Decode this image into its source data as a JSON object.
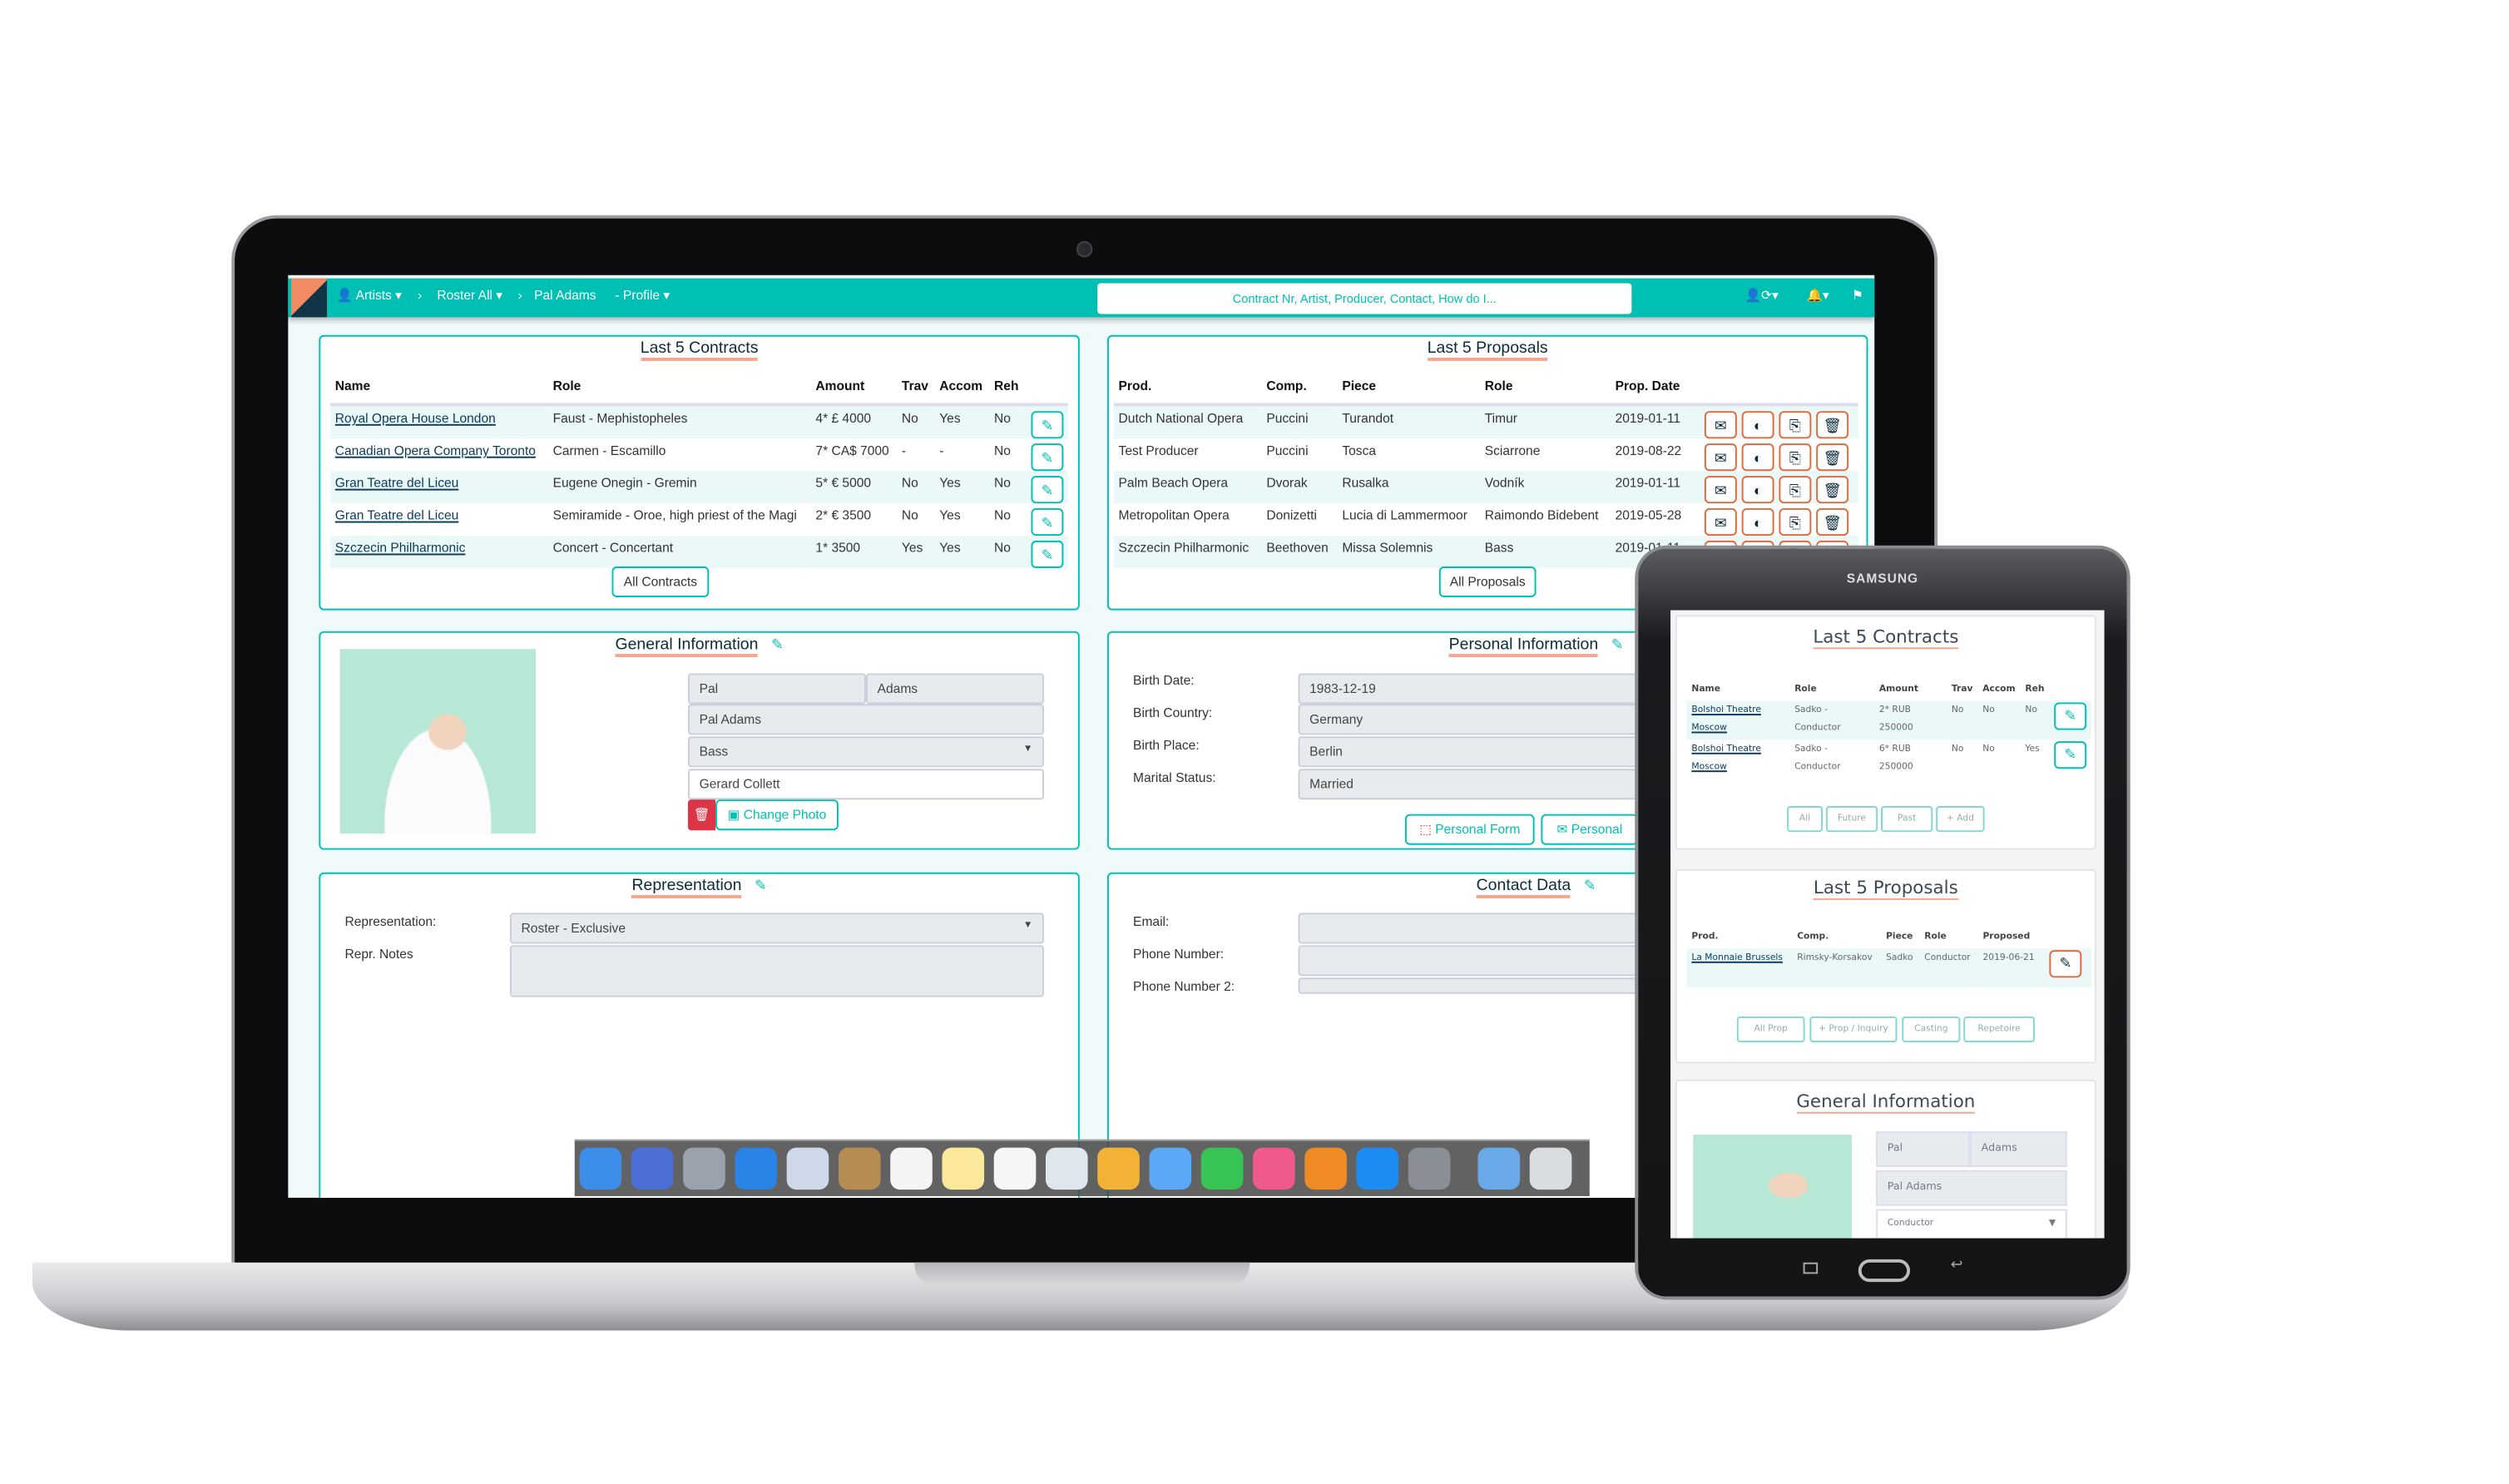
{
  "nav": {
    "breadcrumbs": [
      "Artists",
      "Roster All",
      "Pal Adams",
      "- Profile"
    ],
    "search_placeholder": "Contract Nr, Artist, Producer, Contact, How do I...",
    "icons": [
      "user-sync-icon",
      "bell-icon",
      "flag-icon"
    ]
  },
  "colors": {
    "accent": "#00bfb3",
    "highlight": "#f4a78d",
    "danger": "#dc3545"
  },
  "contracts": {
    "title": "Last 5 Contracts",
    "headers": [
      "Name",
      "Role",
      "Amount",
      "Trav",
      "Accom",
      "Reh"
    ],
    "rows": [
      [
        "Royal Opera House London",
        "Faust - Mephistopheles",
        "4* £ 4000",
        "No",
        "Yes",
        "No"
      ],
      [
        "Canadian Opera Company Toronto",
        "Carmen - Escamillo",
        "7* CA$ 7000",
        "-",
        "-",
        "No"
      ],
      [
        "Gran Teatre del Liceu",
        "Eugene Onegin - Gremin",
        "5* € 5000",
        "No",
        "Yes",
        "No"
      ],
      [
        "Gran Teatre del Liceu",
        "Semiramide - Oroe, high priest of the Magi",
        "2* € 3500",
        "No",
        "Yes",
        "No"
      ],
      [
        "Szczecin Philharmonic",
        "Concert - Concertant",
        "1* 3500",
        "Yes",
        "Yes",
        "No"
      ]
    ],
    "all_label": "All Contracts"
  },
  "proposals": {
    "title": "Last 5 Proposals",
    "headers": [
      "Prod.",
      "Comp.",
      "Piece",
      "Role",
      "Prop. Date"
    ],
    "rows": [
      [
        "Dutch National Opera",
        "Puccini",
        "Turandot",
        "Timur",
        "2019-01-11"
      ],
      [
        "Test Producer",
        "Puccini",
        "Tosca",
        "Sciarrone",
        "2019-08-22"
      ],
      [
        "Palm Beach Opera",
        "Dvorak",
        "Rusalka",
        "Vodník",
        "2019-01-11"
      ],
      [
        "Metropolitan Opera",
        "Donizetti",
        "Lucia di Lammermoor",
        "Raimondo Bidebent",
        "2019-05-28"
      ],
      [
        "Szczecin Philharmonic",
        "Beethoven",
        "Missa Solemnis",
        "Bass",
        "2019-01-11"
      ]
    ],
    "all_label": "All Proposals"
  },
  "general": {
    "title": "General Information",
    "first_name": "Pal",
    "last_name": "Adams",
    "display_name": "Pal Adams",
    "voice": "Bass",
    "manager": "Gerard Collett",
    "change_photo": "Change Photo"
  },
  "personal": {
    "title": "Personal Information",
    "labels": [
      "Birth Date:",
      "Birth Country:",
      "Birth Place:",
      "Marital Status:"
    ],
    "values": [
      "1983-12-19",
      "Germany",
      "Berlin",
      "Married"
    ],
    "form_button": "Personal Form",
    "mail_button": "Personal"
  },
  "representation": {
    "title": "Representation",
    "label": "Representation:",
    "value": "Roster - Exclusive",
    "notes_label": "Repr. Notes",
    "notes": ""
  },
  "contact": {
    "title": "Contact Data",
    "labels": [
      "Email:",
      "Phone Number:",
      "Phone Number 2:"
    ],
    "values": [
      "",
      "",
      ""
    ]
  },
  "dock": {
    "apps": [
      "finder",
      "siri",
      "launchpad",
      "safari",
      "mail",
      "contacts",
      "calendar",
      "notes",
      "reminders",
      "photos-preview",
      "photos",
      "messages",
      "facetime",
      "itunes",
      "ibooks",
      "app-store",
      "system-preferences",
      "downloads",
      "trash"
    ]
  },
  "tablet": {
    "brand": "SAMSUNG",
    "contracts": {
      "title": "Last 5 Contracts",
      "headers": [
        "Name",
        "Role",
        "Amount",
        "Trav",
        "Accom",
        "Reh"
      ],
      "rows": [
        [
          "Bolshoi Theatre Moscow",
          "Sadko - Conductor",
          "2* RUB 250000",
          "No",
          "No",
          "No"
        ],
        [
          "Bolshoi Theatre Moscow",
          "Sadko - Conductor",
          "6* RUB 250000",
          "No",
          "No",
          "Yes"
        ]
      ],
      "buttons": [
        "All",
        "Future",
        "Past",
        "+ Add"
      ]
    },
    "proposals": {
      "title": "Last 5 Proposals",
      "headers": [
        "Prod.",
        "Comp.",
        "Piece",
        "Role",
        "Proposed"
      ],
      "rows": [
        [
          "La Monnaie Brussels",
          "Rimsky-Korsakov",
          "Sadko",
          "Conductor",
          "2019-06-21"
        ]
      ],
      "buttons": [
        "All Prop",
        "+ Prop / Inquiry",
        "Casting",
        "Repetoire"
      ]
    },
    "general": {
      "title": "General Information",
      "first_name": "Pal",
      "last_name": "Adams",
      "display_name": "Pal Adams",
      "voice": "Conductor"
    }
  }
}
